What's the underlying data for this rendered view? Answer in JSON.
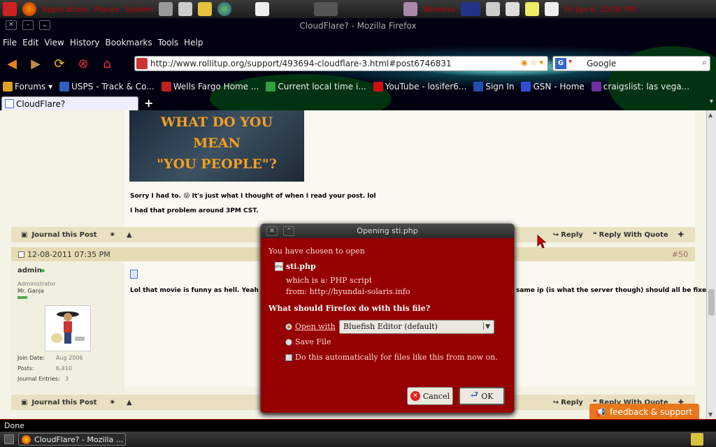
{
  "top_panel": {
    "menus": [
      "Applications",
      "Places",
      "System"
    ],
    "clock_label": "Wireless",
    "right_text": "Fri Jan 6, 10:00 PM"
  },
  "window": {
    "title": "CloudFlare? - Mozilla Firefox"
  },
  "menubar": [
    "File",
    "Edit",
    "View",
    "History",
    "Bookmarks",
    "Tools",
    "Help"
  ],
  "navbar": {
    "url": "http://www.rollitup.org/support/493694-cloudflare-3.html#post6746831",
    "search_value": "Google"
  },
  "bookmarks": [
    {
      "label": "Forums ▾",
      "color": "#e0a020"
    },
    {
      "label": "USPS - Track & Co...",
      "color": "#3060c0"
    },
    {
      "label": "Wells Fargo Home ...",
      "color": "#c02020"
    },
    {
      "label": "Current local time i...",
      "color": "#30a040"
    },
    {
      "label": "YouTube - losifer6...",
      "color": "#d01010"
    },
    {
      "label": "Sign In",
      "color": "#2050b0"
    },
    {
      "label": "GSN - Home",
      "color": "#3050d0"
    },
    {
      "label": "craigslist: las vega...",
      "color": "#7030a0"
    }
  ],
  "tabs": [
    {
      "label": "CloudFlare?"
    }
  ],
  "post1": {
    "image_text": [
      "WHAT DO YOU",
      "MEAN",
      "\"YOU PEOPLE\"?"
    ],
    "line1": "Sorry I had to. 😜 It's just what I thought of when I read your post. lol",
    "line2": "I had that problem around 3PM CST.",
    "journal": "Journal this Post",
    "reply": "Reply",
    "reply_quote": "Reply With Quote"
  },
  "post2": {
    "date": "12-08-2011 07:35 PM",
    "number": "#50",
    "username": "admin",
    "role": "Administrator",
    "subtitle": "Mr. Ganja",
    "join_label": "Join Date:",
    "join_value": "Aug 2006",
    "posts_label": "Posts:",
    "posts_value": "6,410",
    "journal_label": "Journal Entries:",
    "journal_value": "3",
    "text_left": "Lol that movie is funny as hell. Yeah the pro",
    "text_right": "same ip (is what the server though) should all be fixed.",
    "journal": "Journal this Post",
    "reply": "Reply",
    "reply_quote": "Reply With Quote"
  },
  "dialog": {
    "title": "Opening sti.php",
    "intro": "You have chosen to open",
    "filename": "sti.php",
    "which_is": "which is a:  PHP script",
    "from": "from:  http://hyundai-solaris.info",
    "question": "What should Firefox do with this file?",
    "open_with_label": "Open with",
    "app": "Bluefish Editor (default)",
    "save_label": "Save File",
    "auto_label": "Do this automatically for files like this from now on.",
    "cancel": "Cancel",
    "ok": "OK"
  },
  "feedback": "feedback & support",
  "status": "Done",
  "taskbar": {
    "item": "CloudFlare? - Mozilla ..."
  }
}
